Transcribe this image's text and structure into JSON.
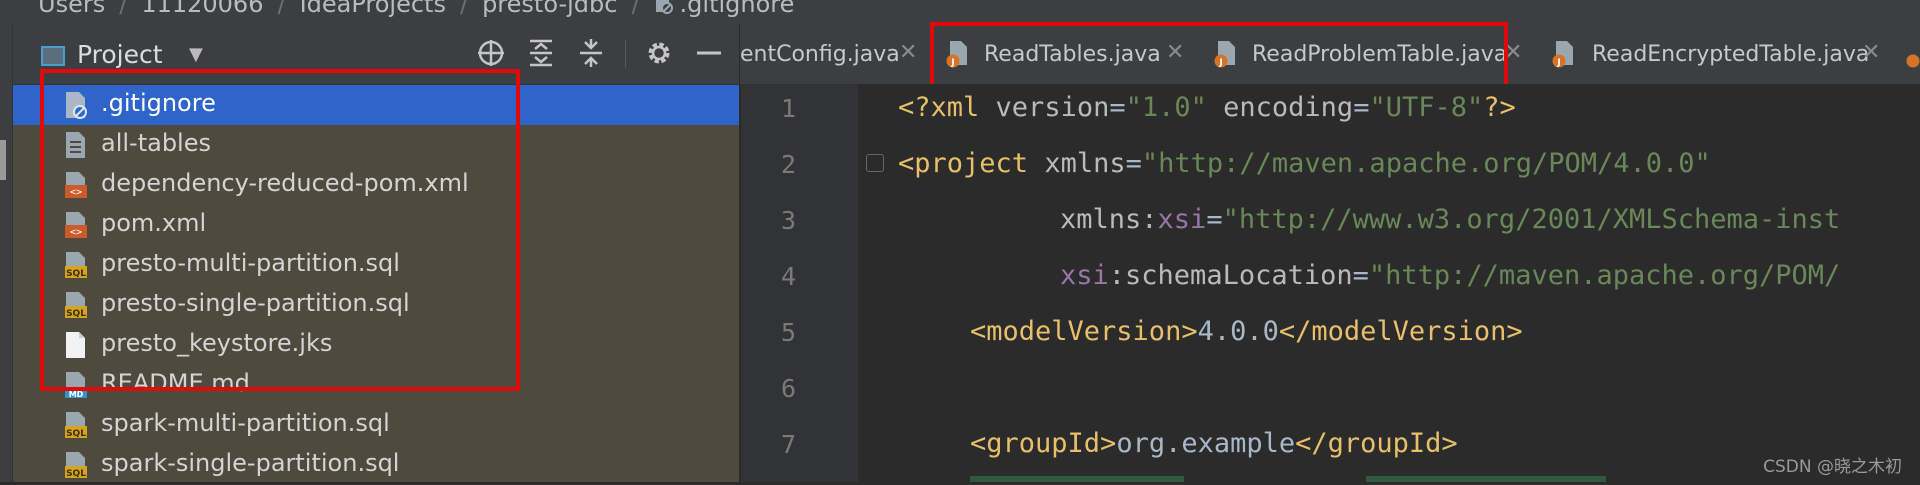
{
  "breadcrumb": [
    "Users",
    "11120066",
    "IdeaProjects",
    "presto-jdbc",
    ".gitignore"
  ],
  "project_panel": {
    "title": "Project",
    "header_icons": [
      "locate-icon",
      "expand-all-icon",
      "collapse-all-icon",
      "gear-icon",
      "minimize-icon"
    ]
  },
  "files": [
    {
      "name": ".gitignore",
      "icon": "gitignore-file-icon",
      "selected": true
    },
    {
      "name": "all-tables",
      "icon": "text-file-icon"
    },
    {
      "name": "dependency-reduced-pom.xml",
      "icon": "xml-file-icon"
    },
    {
      "name": "pom.xml",
      "icon": "xml-file-icon"
    },
    {
      "name": "presto-multi-partition.sql",
      "icon": "sql-file-icon"
    },
    {
      "name": "presto-single-partition.sql",
      "icon": "sql-file-icon"
    },
    {
      "name": "presto_keystore.jks",
      "icon": "blank-file-icon"
    },
    {
      "name": "README.md",
      "icon": "markdown-file-icon"
    },
    {
      "name": "spark-multi-partition.sql",
      "icon": "sql-file-icon"
    },
    {
      "name": "spark-single-partition.sql",
      "icon": "sql-file-icon"
    }
  ],
  "tabs": [
    {
      "label": "entConfig.java"
    },
    {
      "label": "ReadTables.java"
    },
    {
      "label": "ReadProblemTable.java"
    },
    {
      "label": "ReadEncryptedTable.java"
    }
  ],
  "line_numbers": [
    "1",
    "2",
    "3",
    "4",
    "5",
    "6",
    "7"
  ],
  "code": {
    "l1": {
      "a": "<?xml ",
      "b": "version",
      "c": "=",
      "d": "\"1.0\"",
      "e": " encoding",
      "f": "=",
      "g": "\"UTF-8\"",
      "h": "?>"
    },
    "l2": {
      "a": "<project ",
      "b": "xmlns",
      "c": "=",
      "d": "\"http://maven.apache.org/POM/4.0.0\""
    },
    "l3": {
      "a": "xmlns",
      "b": ":",
      "c": "xsi",
      "d": "=",
      "e": "\"http://www.w3.org/2001/XMLSchema-inst"
    },
    "l4": {
      "a": "xsi",
      "b": ":schemaLocation",
      "c": "=",
      "d": "\"http://maven.apache.org/POM/"
    },
    "l5": {
      "a": "<modelVersion>",
      "b": "4.0.0",
      "c": "</modelVersion>"
    },
    "l7": {
      "a": "<groupId>",
      "b": "org.example",
      "c": "</groupId>"
    }
  },
  "watermark": "CSDN @晓之木初",
  "colors": {
    "highlight": "#e00a0a",
    "selection": "#2f65ca"
  }
}
